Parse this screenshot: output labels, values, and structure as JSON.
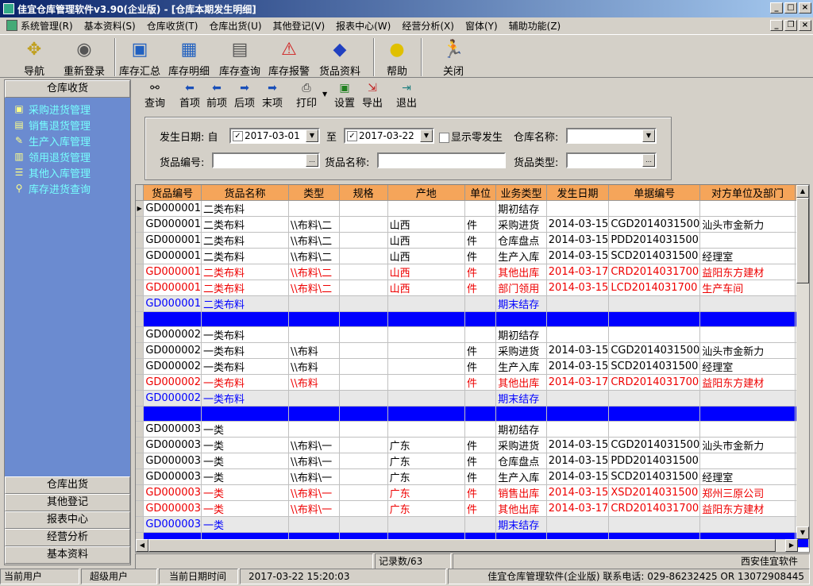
{
  "window": {
    "title": "佳宜仓库管理软件v3.90(企业版)  - [仓库本期发生明细]"
  },
  "menu": [
    "系统管理(R)",
    "基本资料(S)",
    "仓库收货(T)",
    "仓库出货(U)",
    "其他登记(V)",
    "报表中心(W)",
    "经营分析(X)",
    "窗体(Y)",
    "辅助功能(Z)"
  ],
  "toolbar": [
    "导航",
    "重新登录",
    "库存汇总",
    "库存明细",
    "库存查询",
    "库存报警",
    "货品资料",
    "帮助",
    "关闭"
  ],
  "left_panel": {
    "header": "仓库收货",
    "items": [
      "采购进货管理",
      "销售退货管理",
      "生产入库管理",
      "领用退货管理",
      "其他入库管理",
      "库存进货查询"
    ],
    "footers": [
      "仓库出货",
      "其他登记",
      "报表中心",
      "经营分析",
      "基本资料"
    ]
  },
  "subtoolbar": [
    "查询",
    "首项",
    "前项",
    "后项",
    "末项",
    "打印",
    "设置",
    "导出",
    "退出"
  ],
  "filter": {
    "date_label": "发生日期: 自",
    "date_from": "2017-03-01",
    "to_label": "至",
    "date_to": "2017-03-22",
    "show_zero_label": "显示零发生",
    "warehouse_label": "仓库名称:",
    "code_label": "货品编号:",
    "name_label": "货品名称:",
    "type_label": "货品类型:"
  },
  "table": {
    "columns": [
      "货品编号",
      "货品名称",
      "类型",
      "规格",
      "产地",
      "单位",
      "业务类型",
      "发生日期",
      "单据编号",
      "对方单位及部门"
    ],
    "rows": [
      {
        "style": "normal",
        "cells": [
          "GD000001",
          "二类布料",
          "",
          "",
          "",
          "",
          "期初结存",
          "",
          "",
          ""
        ]
      },
      {
        "style": "normal",
        "cells": [
          "GD000001",
          "二类布料",
          "\\\\布料\\二",
          "",
          "山西",
          "件",
          "采购进货",
          "2014-03-15",
          "CGD2014031500",
          "汕头市金新力"
        ]
      },
      {
        "style": "normal",
        "cells": [
          "GD000001",
          "二类布料",
          "\\\\布料\\二",
          "",
          "山西",
          "件",
          "仓库盘点",
          "2014-03-15",
          "PDD2014031500",
          ""
        ]
      },
      {
        "style": "normal",
        "cells": [
          "GD000001",
          "二类布料",
          "\\\\布料\\二",
          "",
          "山西",
          "件",
          "生产入库",
          "2014-03-15",
          "SCD2014031500",
          "经理室"
        ]
      },
      {
        "style": "red",
        "cells": [
          "GD000001",
          "二类布料",
          "\\\\布料\\二",
          "",
          "山西",
          "件",
          "其他出库",
          "2014-03-17",
          "CRD2014031700",
          "益阳东方建材"
        ]
      },
      {
        "style": "red",
        "cells": [
          "GD000001",
          "二类布料",
          "\\\\布料\\二",
          "",
          "山西",
          "件",
          "部门领用",
          "2014-03-15",
          "LCD2014031700",
          "生产车间"
        ]
      },
      {
        "style": "blue",
        "cells": [
          "GD000001",
          "二类布料",
          "",
          "",
          "",
          "",
          "期末结存",
          "",
          "",
          ""
        ]
      },
      {
        "style": "bar",
        "cells": [
          "",
          "",
          "",
          "",
          "",
          "",
          "",
          "",
          "",
          ""
        ]
      },
      {
        "style": "normal",
        "cells": [
          "GD000002",
          "一类布料",
          "",
          "",
          "",
          "",
          "期初结存",
          "",
          "",
          ""
        ]
      },
      {
        "style": "normal",
        "cells": [
          "GD000002",
          "一类布料",
          "\\\\布料",
          "",
          "",
          "件",
          "采购进货",
          "2014-03-15",
          "CGD2014031500",
          "汕头市金新力"
        ]
      },
      {
        "style": "normal",
        "cells": [
          "GD000002",
          "一类布料",
          "\\\\布料",
          "",
          "",
          "件",
          "生产入库",
          "2014-03-15",
          "SCD2014031500",
          "经理室"
        ]
      },
      {
        "style": "red",
        "cells": [
          "GD000002",
          "一类布料",
          "\\\\布料",
          "",
          "",
          "件",
          "其他出库",
          "2014-03-17",
          "CRD2014031700",
          "益阳东方建材"
        ]
      },
      {
        "style": "blue",
        "cells": [
          "GD000002",
          "一类布料",
          "",
          "",
          "",
          "",
          "期末结存",
          "",
          "",
          ""
        ]
      },
      {
        "style": "bar",
        "cells": [
          "",
          "",
          "",
          "",
          "",
          "",
          "",
          "",
          "",
          ""
        ]
      },
      {
        "style": "normal",
        "cells": [
          "GD000003",
          "一类",
          "",
          "",
          "",
          "",
          "期初结存",
          "",
          "",
          ""
        ]
      },
      {
        "style": "normal",
        "cells": [
          "GD000003",
          "一类",
          "\\\\布料\\一",
          "",
          "广东",
          "件",
          "采购进货",
          "2014-03-15",
          "CGD2014031500",
          "汕头市金新力"
        ]
      },
      {
        "style": "normal",
        "cells": [
          "GD000003",
          "一类",
          "\\\\布料\\一",
          "",
          "广东",
          "件",
          "仓库盘点",
          "2014-03-15",
          "PDD2014031500",
          ""
        ]
      },
      {
        "style": "normal",
        "cells": [
          "GD000003",
          "一类",
          "\\\\布料\\一",
          "",
          "广东",
          "件",
          "生产入库",
          "2014-03-15",
          "SCD2014031500",
          "经理室"
        ]
      },
      {
        "style": "red",
        "cells": [
          "GD000003",
          "一类",
          "\\\\布料\\一",
          "",
          "广东",
          "件",
          "销售出库",
          "2014-03-15",
          "XSD2014031500",
          "郑州三原公司"
        ]
      },
      {
        "style": "red",
        "cells": [
          "GD000003",
          "一类",
          "\\\\布料\\一",
          "",
          "广东",
          "件",
          "其他出库",
          "2014-03-17",
          "CRD2014031700",
          "益阳东方建材"
        ]
      },
      {
        "style": "blue",
        "cells": [
          "GD000003",
          "一类",
          "",
          "",
          "",
          "",
          "期末结存",
          "",
          "",
          ""
        ]
      },
      {
        "style": "bar",
        "cells": [
          "",
          "",
          "",
          "",
          "",
          "",
          "",
          "",
          "",
          ""
        ]
      }
    ]
  },
  "record_bar": {
    "count": "记录数/63",
    "company": "西安佳宜软件"
  },
  "statusbar": {
    "user_label": "当前用户",
    "user_value": "超级用户",
    "time_label": "当前日期时间",
    "time_value": "2017-03-22 15:20:03",
    "product": "佳宜仓库管理软件(企业版) 联系电话: 029-86232425 OR 13072908445"
  }
}
